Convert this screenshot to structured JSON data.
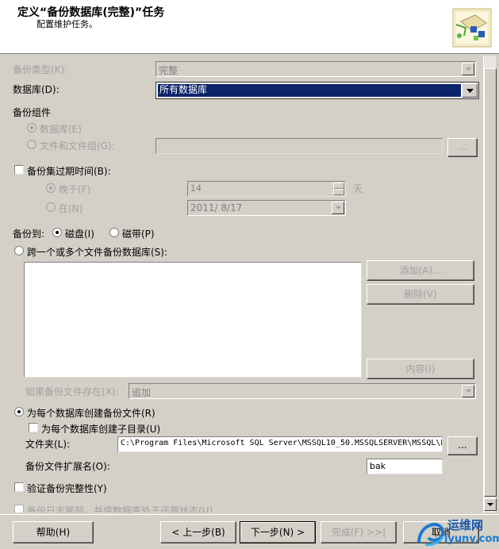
{
  "header": {
    "title": "定义“备份数据库(完整)”任务",
    "subtitle": "配置维护任务。"
  },
  "backup_type": {
    "label": "备份类型(K):",
    "value": "完整"
  },
  "database": {
    "label": "数据库(D):",
    "value": "所有数据库"
  },
  "backup_component": {
    "label": "备份组件",
    "database_option": "数据库(E)",
    "files_option": "文件和文件组(G):",
    "browse_label": "..."
  },
  "expiry": {
    "label": "备份集过期时间(B):",
    "after_label": "晚于(F)",
    "after_value": "14",
    "unit": "天",
    "on_label": "在(N)",
    "on_value": "2011/ 8/17"
  },
  "backup_to": {
    "label": "备份到:",
    "disk": "磁盘(I)",
    "tape": "磁带(P)"
  },
  "span": {
    "label": "跨一个或多个文件备份数据库(S):",
    "add": "添加(A)...",
    "remove": "删除(V)",
    "contents": "内容(I)"
  },
  "if_exists": {
    "label": "如果备份文件存在(X):",
    "value": "追加"
  },
  "per_db": {
    "label": "为每个数据库创建备份文件(R)",
    "subdir": "为每个数据库创建子目录(U)",
    "folder_label": "文件夹(L):",
    "folder_value": "C:\\Program Files\\Microsoft SQL Server\\MSSQL10_50.MSSQLSERVER\\MSSQL\\B",
    "browse_label": "...",
    "ext_label": "备份文件扩展名(O):",
    "ext_value": "bak"
  },
  "verify": {
    "label": "验证备份完整性(Y)"
  },
  "cut_option": {
    "label": "备份日志尾部，并使数据库处于还原状态(U)"
  },
  "footer": {
    "help": "帮助(H)",
    "back": "< 上一步(B)",
    "next": "下一步(N) >",
    "finish": "完成(F) >>|",
    "cancel": "取消"
  },
  "watermark": {
    "text1": "运维网",
    "text2": "iyunv.com"
  }
}
